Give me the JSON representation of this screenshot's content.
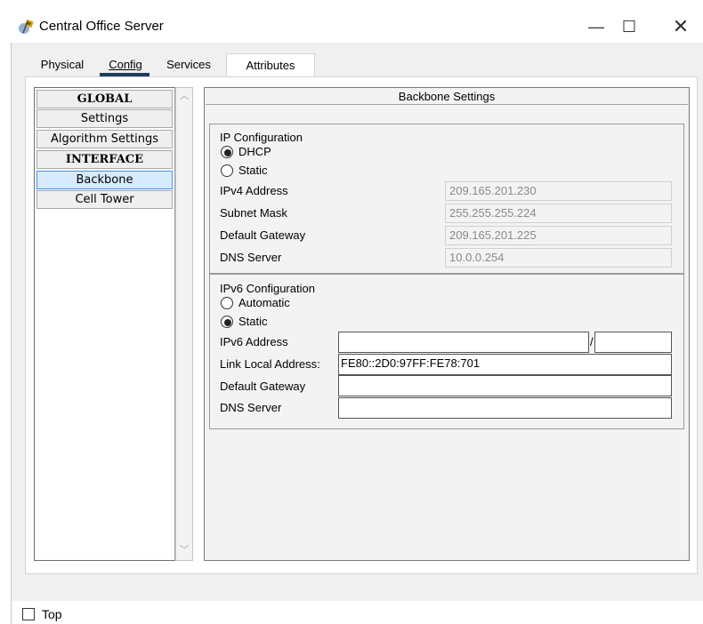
{
  "window": {
    "title": "Central Office Server",
    "minimize_glyph": "—",
    "maximize_glyph": "☐",
    "close_glyph": "✕"
  },
  "tabs": [
    {
      "label": "Physical"
    },
    {
      "label": "Config",
      "active": true
    },
    {
      "label": "Services"
    },
    {
      "label": "Attributes"
    }
  ],
  "sidebar": {
    "items": [
      {
        "label": "GLOBAL",
        "header": true
      },
      {
        "label": "Settings"
      },
      {
        "label": "Algorithm Settings"
      },
      {
        "label": "INTERFACE",
        "header": true
      },
      {
        "label": "Backbone",
        "selected": true
      },
      {
        "label": "Cell Tower"
      }
    ],
    "scroll_up_glyph": "︿",
    "scroll_down_glyph": "﹀"
  },
  "panel": {
    "title": "Backbone Settings",
    "ipv4": {
      "heading": "IP Configuration",
      "dhcp_label": "DHCP",
      "static_label": "Static",
      "mode": "DHCP",
      "rows": [
        {
          "label": "IPv4 Address",
          "value": "209.165.201.230"
        },
        {
          "label": "Subnet Mask",
          "value": "255.255.255.224"
        },
        {
          "label": "Default Gateway",
          "value": "209.165.201.225"
        },
        {
          "label": "DNS Server",
          "value": "10.0.0.254"
        }
      ]
    },
    "ipv6": {
      "heading": "IPv6 Configuration",
      "automatic_label": "Automatic",
      "static_label": "Static",
      "mode": "Static",
      "address_label": "IPv6 Address",
      "address_value": "",
      "prefix_separator": "/",
      "prefix_value": "",
      "link_local_label": "Link Local Address:",
      "link_local_value": "FE80::2D0:97FF:FE78:701",
      "gateway_label": "Default Gateway",
      "gateway_value": "",
      "dns_label": "DNS Server",
      "dns_value": ""
    }
  },
  "footer": {
    "top_label": "Top",
    "top_checked": false
  },
  "colors": {
    "selected_item_bg": "#d7ebff",
    "selected_item_border": "#4a90e2",
    "active_tab_underline": "#1f3a5f"
  }
}
